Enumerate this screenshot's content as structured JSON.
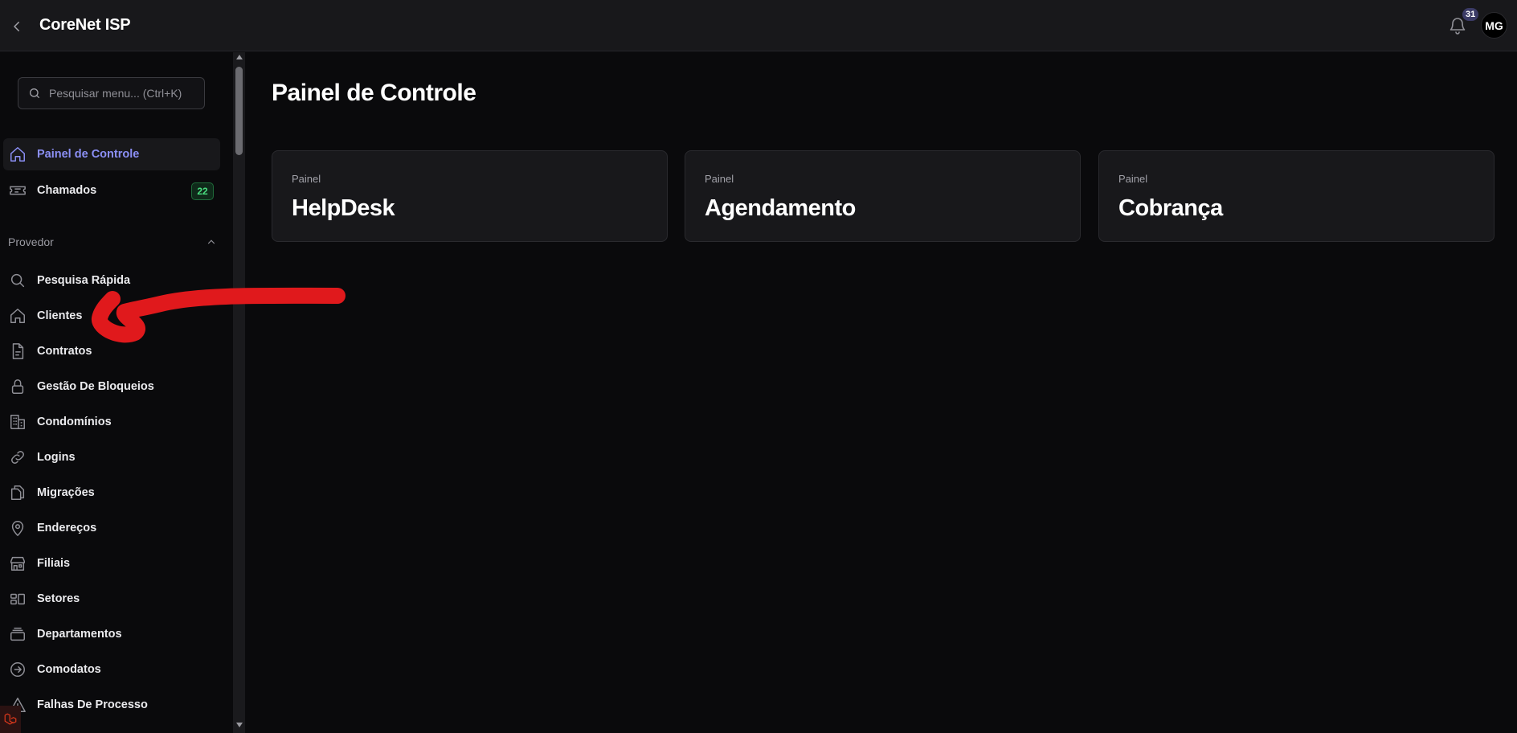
{
  "header": {
    "title": "CoreNet ISP",
    "notifications_count": "31",
    "user_initials": "MG"
  },
  "sidebar": {
    "search": {
      "placeholder": "Pesquisar menu... (Ctrl+K)",
      "value": ""
    },
    "top_items": [
      {
        "label": "Painel de Controle",
        "icon": "home-icon",
        "active": true
      },
      {
        "label": "Chamados",
        "icon": "ticket-icon",
        "badge": "22"
      }
    ],
    "section": {
      "label": "Provedor",
      "expanded": true
    },
    "items": [
      {
        "label": "Pesquisa Rápida",
        "icon": "search-icon"
      },
      {
        "label": "Clientes",
        "icon": "house-icon"
      },
      {
        "label": "Contratos",
        "icon": "document-icon"
      },
      {
        "label": "Gestão De Bloqueios",
        "icon": "lock-icon"
      },
      {
        "label": "Condomínios",
        "icon": "building-icon"
      },
      {
        "label": "Logins",
        "icon": "link-icon"
      },
      {
        "label": "Migrações",
        "icon": "copy-icon"
      },
      {
        "label": "Endereços",
        "icon": "map-pin-icon"
      },
      {
        "label": "Filiais",
        "icon": "store-icon"
      },
      {
        "label": "Setores",
        "icon": "sectors-icon"
      },
      {
        "label": "Departamentos",
        "icon": "stack-icon"
      },
      {
        "label": "Comodatos",
        "icon": "arrow-circle-icon"
      },
      {
        "label": "Falhas De Processo",
        "icon": "warning-icon"
      }
    ]
  },
  "main": {
    "title": "Painel de Controle",
    "cards": [
      {
        "caption": "Painel",
        "title": "HelpDesk"
      },
      {
        "caption": "Painel",
        "title": "Agendamento"
      },
      {
        "caption": "Painel",
        "title": "Cobrança"
      }
    ]
  },
  "colors": {
    "accent": "#8b8ff5",
    "badge_green": "#4ade80",
    "annotation_red": "#e0191c"
  }
}
